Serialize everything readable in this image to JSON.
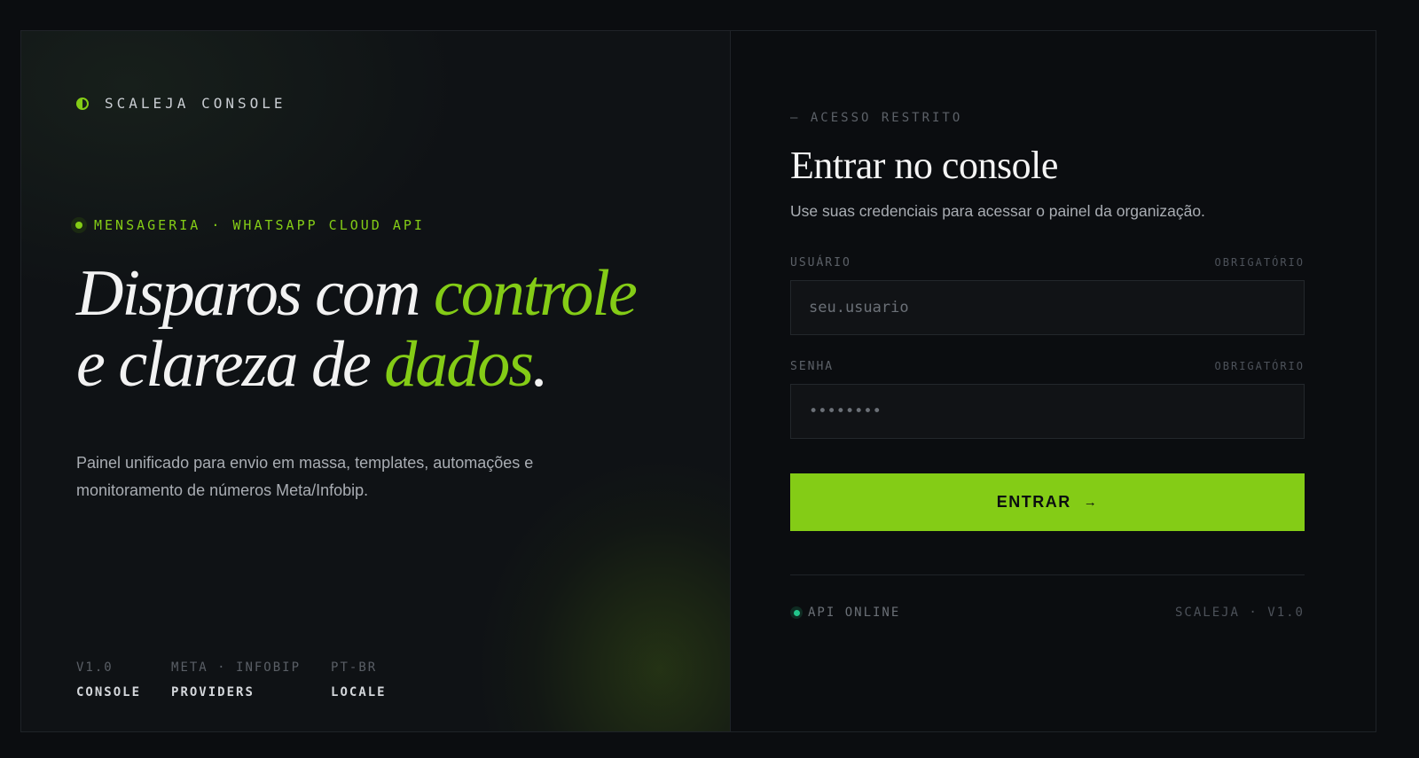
{
  "brand": {
    "name": "SCALEJA CONSOLE",
    "icon": "half-circle-icon"
  },
  "hero": {
    "tag": "MENSAGERIA · WHATSAPP CLOUD API",
    "headline_part1": "Disparos com ",
    "headline_accent1": "controle",
    "headline_part2": "e clareza de ",
    "headline_accent2": "dados",
    "headline_end": ".",
    "description": "Painel unificado para envio em massa, templates, automações e monitoramento de números Meta/Infobip."
  },
  "meta": [
    {
      "label": "V1.0",
      "value": "CONSOLE"
    },
    {
      "label": "META · INFOBIP",
      "value": "PROVIDERS"
    },
    {
      "label": "PT-BR",
      "value": "LOCALE"
    }
  ],
  "login": {
    "eyebrow": "— ACESSO RESTRITO",
    "title": "Entrar no console",
    "description": "Use suas credenciais para acessar o painel da organização.",
    "username": {
      "label": "USUÁRIO",
      "required": "OBRIGATÓRIO",
      "placeholder": "seu.usuario",
      "value": ""
    },
    "password": {
      "label": "SENHA",
      "required": "OBRIGATÓRIO",
      "placeholder": "••••••••",
      "value": ""
    },
    "submit_label": "ENTRAR",
    "submit_arrow": "→"
  },
  "footer": {
    "status": "API ONLINE",
    "version": "SCALEJA · V1.0"
  },
  "colors": {
    "accent": "#84cc16",
    "background": "#0b0d10",
    "status_online": "#22c58b"
  }
}
